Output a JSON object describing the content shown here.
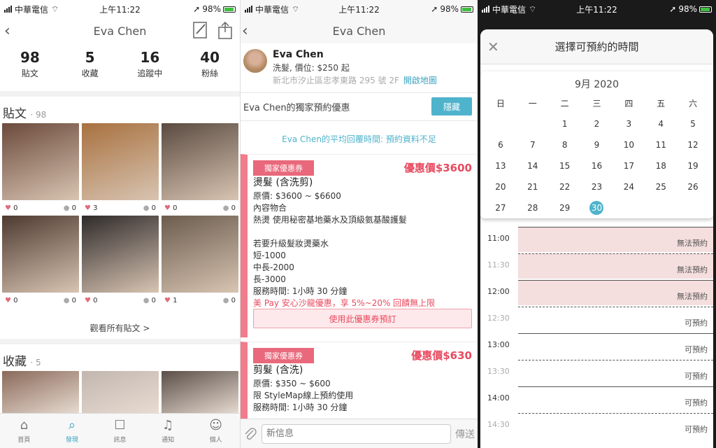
{
  "status": {
    "carrier": "中華電信",
    "time": "上午11:22",
    "battery": "98%"
  },
  "screen1": {
    "nav_title": "Eva Chen",
    "stats": [
      {
        "num": "98",
        "label": "貼文"
      },
      {
        "num": "5",
        "label": "收藏"
      },
      {
        "num": "16",
        "label": "追蹤中"
      },
      {
        "num": "40",
        "label": "粉絲"
      }
    ],
    "posts_title": "貼文",
    "posts_count": "· 98",
    "posts": [
      {
        "likes": "0",
        "comments": "0",
        "color": "#6b4a3c"
      },
      {
        "likes": "3",
        "comments": "0",
        "color": "#a8713f"
      },
      {
        "likes": "0",
        "comments": "0",
        "color": "#5a4a40"
      },
      {
        "likes": "0",
        "comments": "0",
        "color": "#4d3a30"
      },
      {
        "likes": "0",
        "comments": "0",
        "color": "#2e2a2a"
      },
      {
        "likes": "1",
        "comments": "0",
        "color": "#6b5c4e"
      }
    ],
    "more_posts": "觀看所有貼文 >",
    "saved_title": "收藏",
    "saved_count": "· 5",
    "saved": [
      {
        "color": "#8a6a5a"
      },
      {
        "color": "#c2b6b0"
      },
      {
        "color": "#5b4e48"
      }
    ],
    "tabs": [
      {
        "label": "首頁",
        "icon": "home-icon"
      },
      {
        "label": "發現",
        "icon": "search-icon",
        "active": true
      },
      {
        "label": "訊息",
        "icon": "chat-icon"
      },
      {
        "label": "通知",
        "icon": "bell-icon"
      },
      {
        "label": "個人",
        "icon": "person-icon"
      }
    ]
  },
  "screen2": {
    "nav_title": "Eva Chen",
    "profile": {
      "name": "Eva Chen",
      "line": "洗髮, 價位: $250 起",
      "address": "新北市汐止區忠孝東路 295 號 2F",
      "map_link": "開啟地圖"
    },
    "offer_title": "Eva Chen的獨家預約優惠",
    "hide_label": "隱藏",
    "avg_reply": "Eva Chen的平均回覆時間: 預約資料不足",
    "coupons": [
      {
        "tag": "獨家優惠券",
        "price": "優惠價$3600",
        "title": "燙髮 (含洗剪)",
        "lines": [
          "原價: $3600 ~ $6600",
          "內容物合",
          "熱燙 使用秘密基地藥水及頂級氨基酸護髮",
          "",
          "若要升級髮妝燙藥水",
          "短-1000",
          "中長-2000",
          "長-3000",
          "服務時間: 1小時 30 分鐘"
        ],
        "promo": "美 Pay 安心沙龍優惠，享 5%~20% 回饋無上限",
        "button": "使用此優惠券預訂"
      },
      {
        "tag": "獨家優惠券",
        "price": "優惠價$630",
        "title": "剪髮 (含洗)",
        "lines": [
          "原價: $350 ~ $600",
          "限 StyleMap線上預約使用",
          "服務時間: 1小時 30 分鐘"
        ]
      }
    ],
    "message_placeholder": "新信息",
    "send_label": "傳送"
  },
  "screen3": {
    "sheet_title": "選擇可預約的時間",
    "month": "9月 2020",
    "weekdays": [
      "日",
      "一",
      "二",
      "三",
      "四",
      "五",
      "六"
    ],
    "days": [
      "",
      "",
      "1",
      "2",
      "3",
      "4",
      "5",
      "6",
      "7",
      "8",
      "9",
      "10",
      "11",
      "12",
      "13",
      "14",
      "15",
      "16",
      "17",
      "18",
      "19",
      "20",
      "21",
      "22",
      "23",
      "24",
      "25",
      "26",
      "27",
      "28",
      "29",
      "30",
      "",
      "",
      ""
    ],
    "selected_day": "30",
    "slots": [
      {
        "time": "11:00",
        "status": "無法預約",
        "full": true,
        "dim": false
      },
      {
        "time": "11:30",
        "status": "無法預約",
        "full": true,
        "dim": true
      },
      {
        "time": "12:00",
        "status": "無法預約",
        "full": true,
        "dim": false
      },
      {
        "time": "12:30",
        "status": "可預約",
        "full": false,
        "dim": true
      },
      {
        "time": "13:00",
        "status": "可預約",
        "full": false,
        "dim": false
      },
      {
        "time": "13:30",
        "status": "可預約",
        "full": false,
        "dim": true
      },
      {
        "time": "14:00",
        "status": "可預約",
        "full": false,
        "dim": false
      },
      {
        "time": "14:30",
        "status": "可預約",
        "full": false,
        "dim": true
      }
    ],
    "accent": "#4fb3cc"
  }
}
